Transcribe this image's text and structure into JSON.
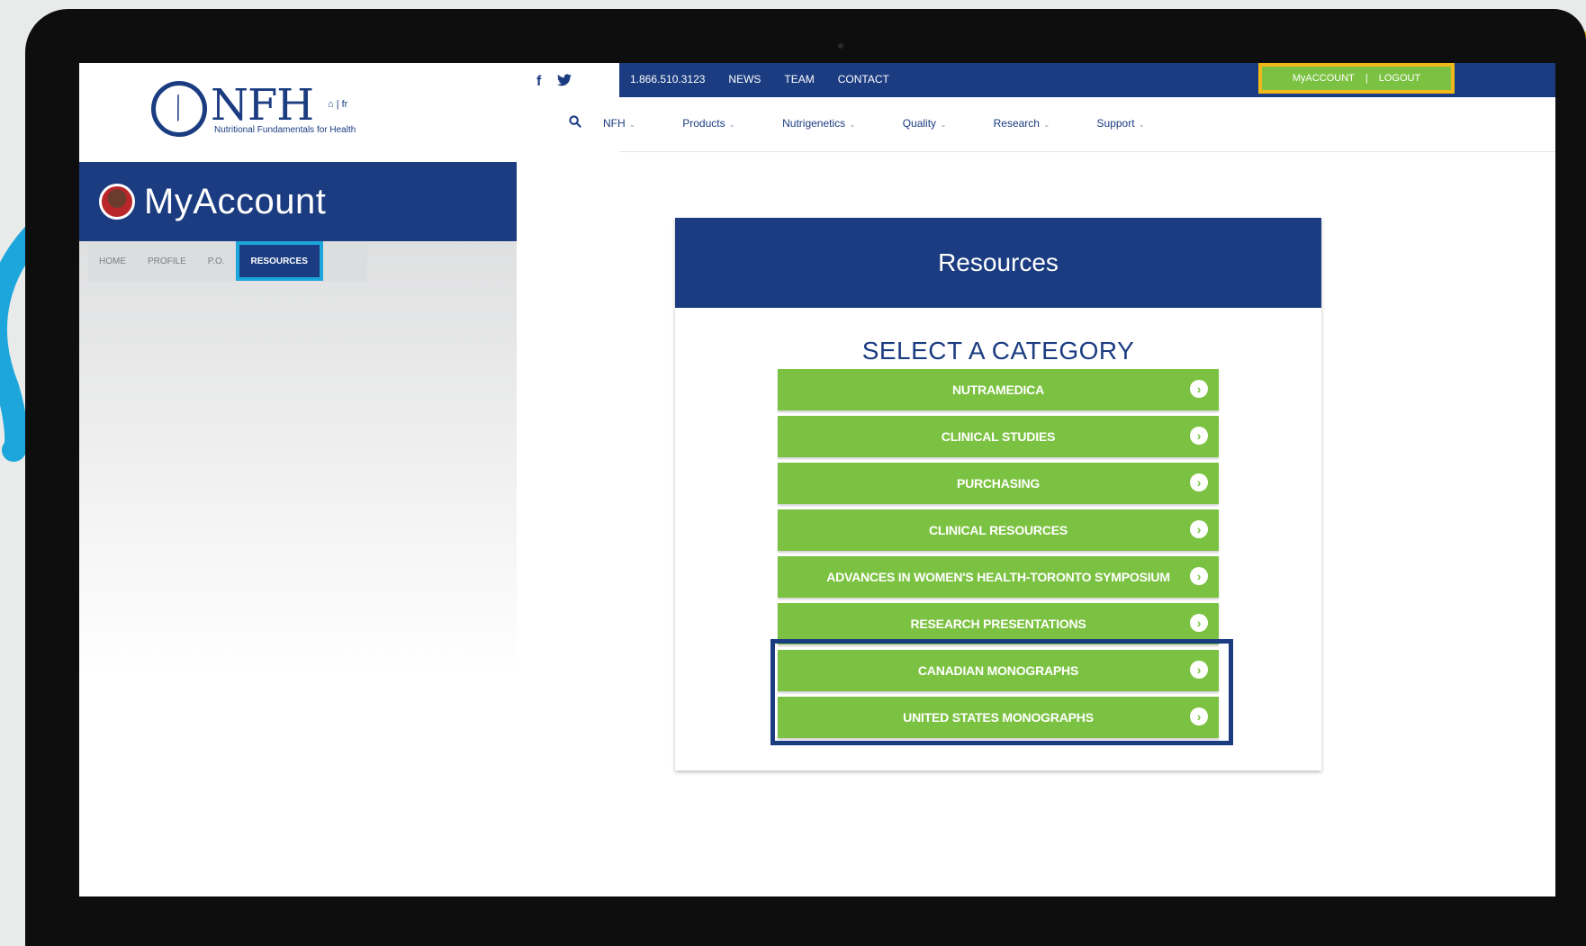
{
  "header": {
    "logo_text": "NFH",
    "logo_tagline": "Nutritional Fundamentals for Health",
    "logo_lang": "⌂ | fr",
    "social": {
      "facebook": "f",
      "twitter": "🐦"
    },
    "topbar": {
      "phone": "1.866.510.3123",
      "links": [
        "NEWS",
        "TEAM",
        "CONTACT"
      ],
      "account_label": "MyACCOUNT",
      "separator": "|",
      "logout_label": "LOGOUT"
    },
    "search_icon": "search-icon",
    "nav": [
      "NFH",
      "Products",
      "Nutrigenetics",
      "Quality",
      "Research",
      "Support"
    ]
  },
  "sidebar": {
    "title": "MyAccount",
    "tabs": [
      "HOME",
      "PROFILE",
      "P.O.",
      "RESOURCES"
    ],
    "active_tab": "RESOURCES"
  },
  "resources": {
    "title": "Resources",
    "subtitle": "SELECT A CATEGORY",
    "categories": [
      "NUTRAMEDICA",
      "CLINICAL STUDIES",
      "PURCHASING",
      "CLINICAL RESOURCES",
      "ADVANCES IN WOMEN'S HEALTH-TORONTO SYMPOSIUM",
      "RESEARCH PRESENTATIONS",
      "CANADIAN MONOGRAPHS",
      "UNITED STATES MONOGRAPHS"
    ],
    "arrow_icon": "›"
  },
  "colors": {
    "brand_blue": "#1b3c81",
    "green": "#7cc242",
    "highlight_yellow": "#f1b81a",
    "highlight_cyan": "#1da6db"
  }
}
